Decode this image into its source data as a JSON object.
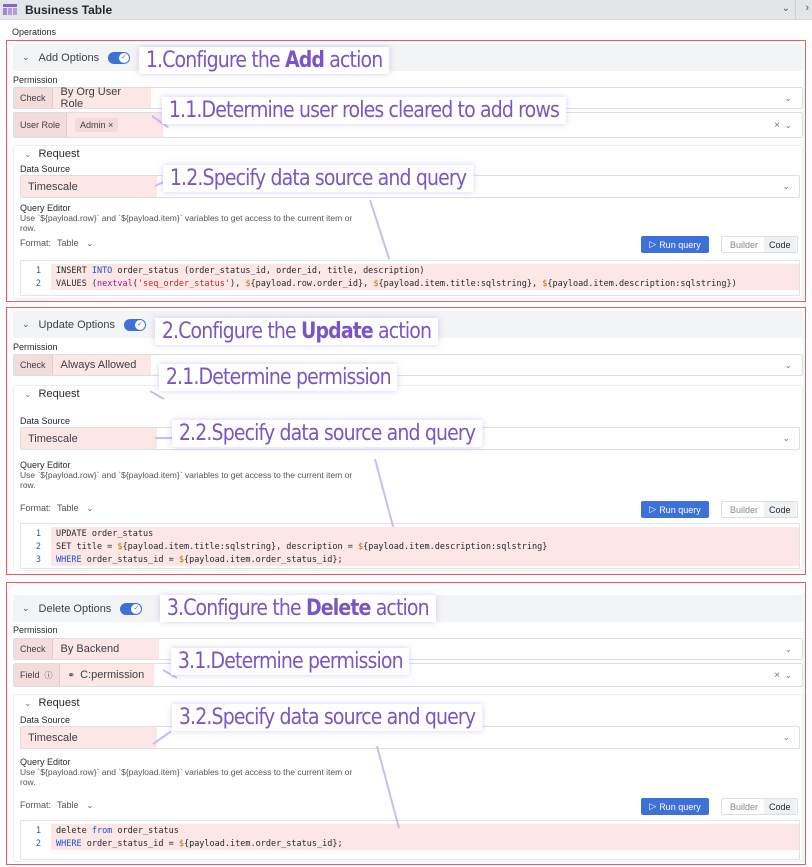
{
  "window": {
    "title": "Business Table",
    "icon": "table-icon",
    "collapse_icon": "chevron-down-icon",
    "more_icon": "chevron-right-icon"
  },
  "operations_label": "Operations",
  "colors": {
    "accent": "#3d71d9",
    "annotation_text": "#7a55c5",
    "highlight_border": "#ef5b5b",
    "highlight_fill": "#fde6e6"
  },
  "sections": [
    {
      "header": "Add Options",
      "enabled": true,
      "permission_label": "Permission",
      "check_label": "Check",
      "check_value": "By Org User Role",
      "extra_row": {
        "label": "User Role",
        "chips": [
          "Admin"
        ]
      },
      "request_label": "Request",
      "data_source_label": "Data Source",
      "data_source": "Timescale",
      "query_editor_title": "Query Editor",
      "query_editor_desc": "Use `${payload.row}` and `${payload.item}` variables to get access to the current item or row.",
      "format_label": "Format:",
      "format_value": "Table",
      "run_query": "Run query",
      "mode_builder": "Builder",
      "mode_code": "Code",
      "code_lines": [
        "INSERT INTO order_status (order_status_id, order_id, title, description)",
        "VALUES (nextval('seq_order_status'), ${payload.row.order_id}, ${payload.item.title:sqlstring}, ${payload.item.description:sqlstring})"
      ],
      "callouts": {
        "main_prefix": "1.Configure the ",
        "main_bold": "Add",
        "main_suffix": " action",
        "permission": "1.1.Determine user roles cleared to add rows",
        "request": "1.2.Specify data source and query"
      }
    },
    {
      "header": "Update Options",
      "enabled": true,
      "permission_label": "Permission",
      "check_label": "Check",
      "check_value": "Always Allowed",
      "request_label": "Request",
      "data_source_label": "Data Source",
      "data_source": "Timescale",
      "query_editor_title": "Query Editor",
      "query_editor_desc": "Use `${payload.row}` and `${payload.item}` variables to get access to the current item or row.",
      "format_label": "Format:",
      "format_value": "Table",
      "run_query": "Run query",
      "mode_builder": "Builder",
      "mode_code": "Code",
      "code_lines": [
        "UPDATE order_status",
        "SET title = ${payload.item.title:sqlstring}, description = ${payload.item.description:sqlstring}",
        "WHERE order_status_id = ${payload.item.order_status_id};"
      ],
      "callouts": {
        "main_prefix": "2.Configure the ",
        "main_bold": "Update",
        "main_suffix": " action",
        "permission": "2.1.Determine permission",
        "request": "2.2.Specify data source and query"
      }
    },
    {
      "header": "Delete Options",
      "enabled": true,
      "permission_label": "Permission",
      "check_label": "Check",
      "check_value": "By Backend",
      "extra_row": {
        "label": "Field",
        "value": "C:permission"
      },
      "request_label": "Request",
      "data_source_label": "Data Source",
      "data_source": "Timescale",
      "query_editor_title": "Query Editor",
      "query_editor_desc": "Use `${payload.row}` and `${payload.item}` variables to get access to the current item or row.",
      "format_label": "Format:",
      "format_value": "Table",
      "run_query": "Run query",
      "mode_builder": "Builder",
      "mode_code": "Code",
      "code_lines": [
        "delete from order_status",
        "WHERE order_status_id = ${payload.item.order_status_id};"
      ],
      "callouts": {
        "main_prefix": "3.Configure the ",
        "main_bold": "Delete",
        "main_suffix": " action",
        "permission": "3.1.Determine permission",
        "request": "3.2.Specify data source and query"
      }
    }
  ]
}
